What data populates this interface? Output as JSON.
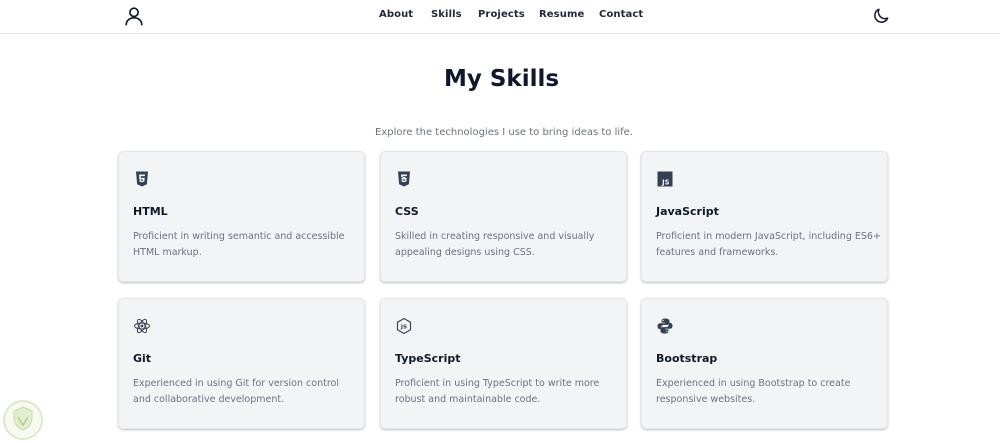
{
  "nav": {
    "logo_icon": "user-outline-icon",
    "links": [
      "About",
      "Skills",
      "Projects",
      "Resume",
      "Contact"
    ],
    "theme_icon": "moon-icon"
  },
  "page": {
    "title": "My Skills",
    "subtitle": "Explore the technologies I use to bring ideas to life."
  },
  "skills": [
    {
      "name": "HTML",
      "icon": "html5-icon",
      "description": "Proficient in writing semantic and accessible HTML markup."
    },
    {
      "name": "CSS",
      "icon": "css3-icon",
      "description": "Skilled in creating responsive and visually appealing designs using CSS."
    },
    {
      "name": "JavaScript",
      "icon": "javascript-icon",
      "description": "Proficient in modern JavaScript, including ES6+ features and frameworks."
    },
    {
      "name": "Git",
      "icon": "react-atom-icon",
      "description": "Experienced in using Git for version control and collaborative development."
    },
    {
      "name": "TypeScript",
      "icon": "nodejs-hexagon-icon",
      "description": "Proficient in using TypeScript to write more robust and maintainable code."
    },
    {
      "name": "Bootstrap",
      "icon": "python-icon",
      "description": "Experienced in using Bootstrap to create responsive websites."
    }
  ],
  "colors": {
    "text": "#0f172a",
    "muted": "#6b7280",
    "card_bg": "#f3f4f6",
    "icon": "#334155"
  }
}
